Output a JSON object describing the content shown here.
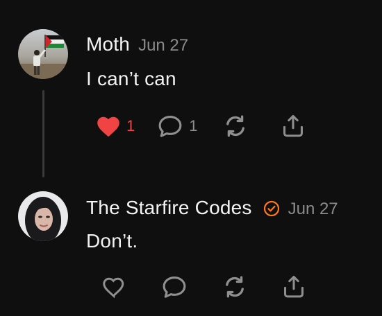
{
  "posts": [
    {
      "author": "Moth",
      "date": "Jun 27",
      "text": "I can’t can",
      "likes": "1",
      "replies": "1",
      "liked": true,
      "verified": false
    },
    {
      "author": "The Starfire Codes",
      "date": "Jun 27",
      "text": "Don’t.",
      "liked": false,
      "verified": true
    }
  ],
  "colors": {
    "background": "#0f0f0f",
    "like_active": "#f04444",
    "verified_badge": "#ff7a1a",
    "muted": "#8b8b8b"
  },
  "icons": [
    "heart-icon",
    "comment-icon",
    "repost-icon",
    "share-icon",
    "verified-icon"
  ]
}
